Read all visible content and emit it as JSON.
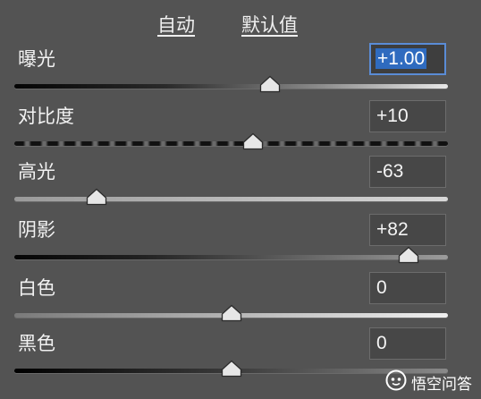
{
  "header": {
    "auto_label": "自动",
    "defaults_label": "默认值"
  },
  "sliders": [
    {
      "key": "exposure",
      "label": "曝光",
      "value": "+1.00",
      "position": 0.59,
      "selected": true
    },
    {
      "key": "contrast",
      "label": "对比度",
      "value": "+10",
      "position": 0.55,
      "selected": false
    },
    {
      "key": "highlights",
      "label": "高光",
      "value": "-63",
      "position": 0.19,
      "selected": false
    },
    {
      "key": "shadows",
      "label": "阴影",
      "value": "+82",
      "position": 0.91,
      "selected": false
    },
    {
      "key": "whites",
      "label": "白色",
      "value": "0",
      "position": 0.5,
      "selected": false
    },
    {
      "key": "blacks",
      "label": "黑色",
      "value": "0",
      "position": 0.5,
      "selected": false
    }
  ],
  "watermark": {
    "text": "悟空问答",
    "icon": "wukong-logo-icon"
  },
  "colors": {
    "panel_bg": "#535353",
    "selection": "#2f6bbf",
    "text": "#f2f2f2"
  }
}
